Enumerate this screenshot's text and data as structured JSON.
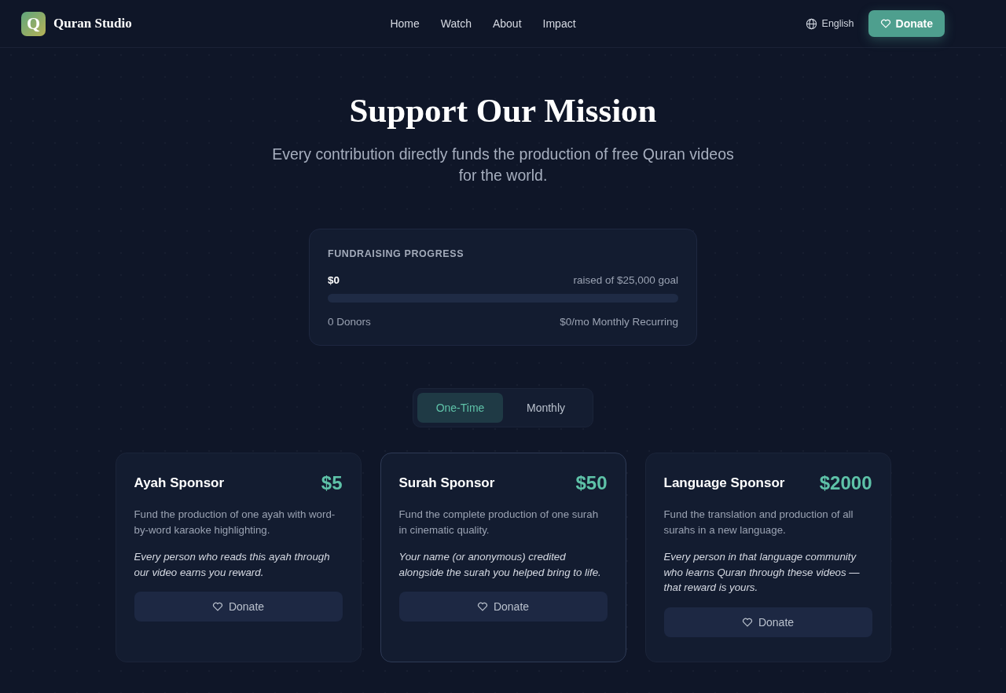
{
  "header": {
    "logo_letter": "Q",
    "brand": "Quran Studio",
    "nav": [
      {
        "label": "Home"
      },
      {
        "label": "Watch"
      },
      {
        "label": "About"
      },
      {
        "label": "Impact"
      }
    ],
    "language": "English",
    "donate_button": "Donate"
  },
  "hero": {
    "title": "Support Our Mission",
    "subtitle": "Every contribution directly funds the production of free Quran videos for the world."
  },
  "progress": {
    "heading": "FUNDRAISING PROGRESS",
    "raised": "$0",
    "goal": "raised of $25,000 goal",
    "donors": "0 Donors",
    "recurring": "$0/mo Monthly Recurring"
  },
  "frequency_tabs": [
    {
      "label": "One-Time",
      "selected": true
    },
    {
      "label": "Monthly",
      "selected": false
    }
  ],
  "tiers": [
    {
      "name": "Ayah Sponsor",
      "price": "$5",
      "description": "Fund the production of one ayah with word-by-word karaoke highlighting.",
      "reward": "Every person who reads this ayah through our video earns you reward.",
      "button": "Donate",
      "highlighted": false
    },
    {
      "name": "Surah Sponsor",
      "price": "$50",
      "description": "Fund the complete production of one surah in cinematic quality.",
      "reward": "Your name (or anonymous) credited alongside the surah you helped bring to life.",
      "button": "Donate",
      "highlighted": true
    },
    {
      "name": "Language Sponsor",
      "price": "$2000",
      "description": "Fund the translation and production of all surahs in a new language.",
      "reward": "Every person in that language community who learns Quran through these videos — that reward is yours.",
      "button": "Donate",
      "highlighted": false
    }
  ]
}
